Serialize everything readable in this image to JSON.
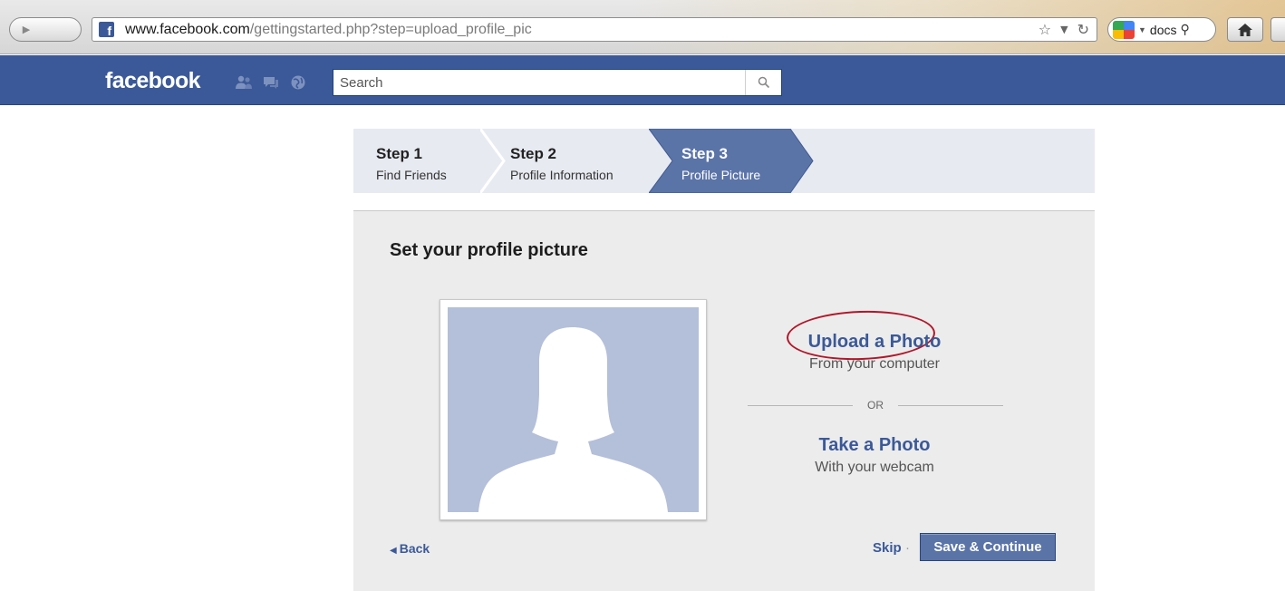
{
  "browser": {
    "nav": {
      "back_icon": "◀",
      "forward_icon": "▶"
    },
    "favicon_letter": "f",
    "url": {
      "host": "www.facebook.com",
      "path": "/gettingstarted.php?step=upload_profile_pic"
    },
    "url_icons": [
      "star-icon",
      "dropdown-icon",
      "reload-icon"
    ],
    "search_engine_text": "docs",
    "home_icon": "home-icon"
  },
  "fb_header": {
    "logo": "facebook",
    "search": {
      "placeholder": "Search"
    },
    "jewels": [
      "friend-requests-icon",
      "messages-icon",
      "notifications-icon"
    ],
    "brand_color": "#3b5998"
  },
  "steps": [
    {
      "number": "Step 1",
      "label": "Find Friends",
      "active": false
    },
    {
      "number": "Step 2",
      "label": "Profile Information",
      "active": false
    },
    {
      "number": "Step 3",
      "label": "Profile Picture",
      "active": true
    }
  ],
  "main": {
    "title": "Set your profile picture",
    "upload": {
      "label": "Upload a Photo",
      "sub": "From your computer"
    },
    "or_label": "OR",
    "take": {
      "label": "Take a Photo",
      "sub": "With your webcam"
    },
    "back_label": "Back",
    "skip_label": "Skip",
    "skip_sep": "·",
    "save_label": "Save & Continue"
  },
  "colors": {
    "accent": "#3b5998",
    "active_step": "#5b74a8",
    "highlight_circle": "#b0172a",
    "placeholder_bg": "#b4bfd9"
  }
}
